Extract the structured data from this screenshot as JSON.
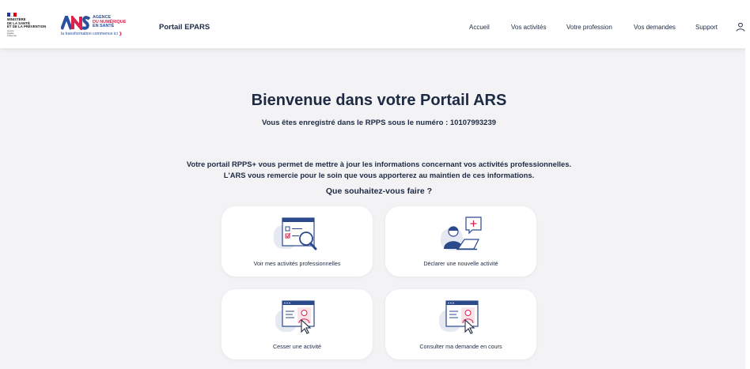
{
  "header": {
    "ministry_lines": [
      "MINISTÈRE",
      "DE LA SANTÉ",
      "ET DE LA PRÉVENTION"
    ],
    "motto_lines": [
      "Liberté",
      "Égalité",
      "Fraternité"
    ],
    "agency_lines": [
      "AGENCE",
      "DU NUMÉRIQUE",
      "EN SANTÉ"
    ],
    "agency_tagline": "la transformation commence ici",
    "portal_name": "Portail EPARS",
    "nav": [
      "Accueil",
      "Vos activités",
      "Votre profession",
      "Vos demandes",
      "Support"
    ]
  },
  "main": {
    "title": "Bienvenue dans votre Portail ARS",
    "rpps_line": "Vous êtes enregistré dans le RPPS sous le numéro : 10107993239",
    "intro_line1": "Votre portail RPPS+ vous permet de mettre à jour les informations concernant vos activités professionnelles.",
    "intro_line2": "L'ARS vous remercie pour le soin que vous apporterez au maintien de ces informations.",
    "question": "Que souhaitez-vous faire ?"
  },
  "cards": [
    {
      "label": "Voir mes activités professionnelles",
      "icon": "checklist-magnifier-icon"
    },
    {
      "label": "Déclarer une nouvelle activité",
      "icon": "person-laptop-plus-icon"
    },
    {
      "label": "Cesser une activité",
      "icon": "browser-user-cursor-icon"
    },
    {
      "label": "Consulter ma demande en cours",
      "icon": "browser-user-cursor-icon"
    }
  ],
  "colors": {
    "navy": "#1e2a44",
    "accent_red": "#d6234f",
    "icon_blue": "#2b4a8c",
    "background": "#f3f3f5"
  }
}
